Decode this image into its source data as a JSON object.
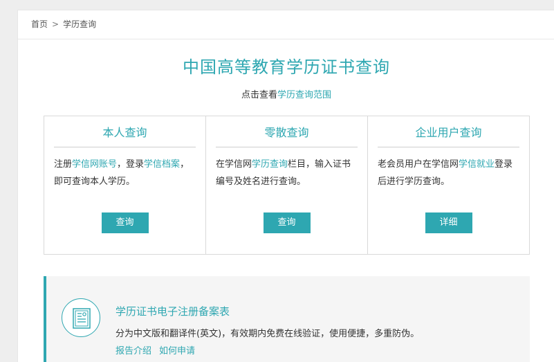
{
  "breadcrumb": {
    "home": "首页",
    "separator": ">",
    "current": "学历查询"
  },
  "title": "中国高等教育学历证书查询",
  "subtitle": {
    "prefix": "点击查看",
    "link": "学历查询范围"
  },
  "cards": [
    {
      "title": "本人查询",
      "text": [
        "注册",
        "学信网账号",
        "，登录",
        "学信档案",
        "，即可查询本人学历。"
      ],
      "button": "查询"
    },
    {
      "title": "零散查询",
      "text": [
        "在学信网",
        "学历查询",
        "栏目，输入证书编号及姓名进行查询。"
      ],
      "button": "查询"
    },
    {
      "title": "企业用户查询",
      "text": [
        "老会员用户在学信网",
        "学信就业",
        "登录后进行学历查询。"
      ],
      "button": "详细"
    }
  ],
  "record": {
    "icon": "certificate-icon",
    "title": "学历证书电子注册备案表",
    "description": "分为中文版和翻译件(英文)，有效期内免费在线验证，使用便捷，多重防伪。",
    "links": [
      "报告介绍",
      "如何申请"
    ]
  },
  "colors": {
    "accent": "#2ea7b1",
    "background": "#eeeeee",
    "card_border": "#d9d9d9"
  }
}
